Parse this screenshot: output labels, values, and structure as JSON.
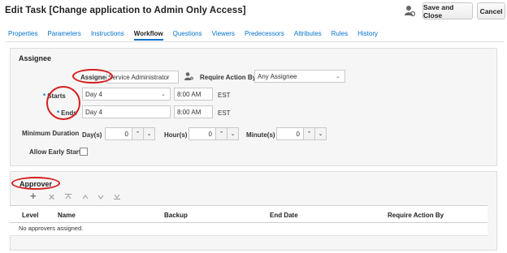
{
  "header": {
    "title": "Edit Task [Change application to Admin Only Access]",
    "save_label": "Save and Close",
    "cancel_label": "Cancel",
    "user_icon": "user-settings-icon"
  },
  "tabs": [
    {
      "label": "Properties"
    },
    {
      "label": "Parameters"
    },
    {
      "label": "Instructions"
    },
    {
      "label": "Workflow",
      "active": true
    },
    {
      "label": "Questions"
    },
    {
      "label": "Viewers"
    },
    {
      "label": "Predecessors"
    },
    {
      "label": "Attributes"
    },
    {
      "label": "Rules"
    },
    {
      "label": "History"
    }
  ],
  "assignee_section": {
    "title": "Assignee",
    "assignee_label": "Assignee",
    "assignee_value": "Service Administrator",
    "require_action_label": "Require Action By",
    "require_action_value": "Any Assignee",
    "starts_label": "Starts",
    "starts_day": "Day 4",
    "starts_time": "8:00 AM",
    "starts_tz": "EST",
    "ends_label": "Ends",
    "ends_day": "Day 4",
    "ends_time": "8:00 AM",
    "ends_tz": "EST",
    "required_marker": "*",
    "min_duration_label": "Minimum Duration",
    "days_label": "Day(s)",
    "days_value": "0",
    "hours_label": "Hour(s)",
    "hours_value": "0",
    "minutes_label": "Minute(s)",
    "minutes_value": "0",
    "allow_early_start_label": "Allow Early Start",
    "allow_early_start_checked": false
  },
  "approver_section": {
    "title": "Approver",
    "columns": [
      "Level",
      "Name",
      "Backup",
      "End Date",
      "Require Action By"
    ],
    "empty_text": "No approvers assigned."
  },
  "colors": {
    "accent": "#0572ce",
    "annotation": "#d61f1f",
    "panel_bg": "#f6f6f6"
  }
}
